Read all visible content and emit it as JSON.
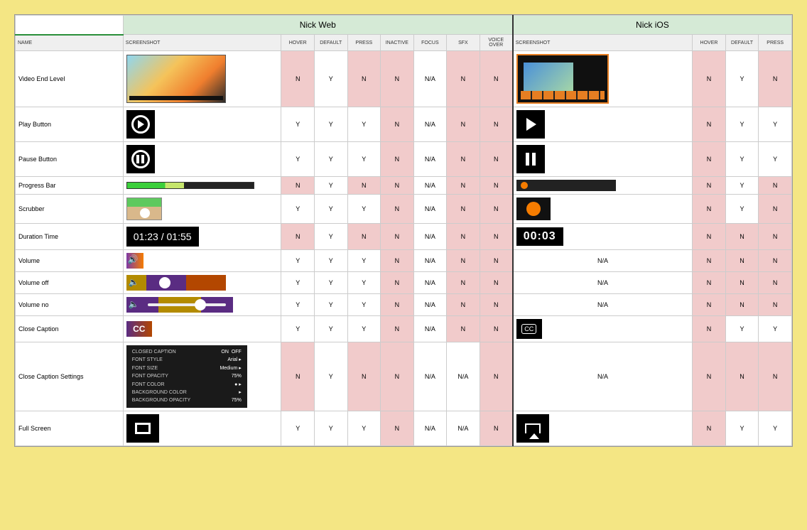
{
  "platforms": {
    "web": "Nick Web",
    "ios": "Nick iOS"
  },
  "col_headers": {
    "name": "NAME",
    "screenshot": "SCREENSHOT",
    "hover": "HOVER",
    "default": "DEFAULT",
    "press": "PRESS",
    "inactive": "INACTIVE",
    "focus": "FOCUS",
    "sfx": "SFX",
    "voice_over": "VOICE OVER"
  },
  "thumbs": {
    "time_web": "01:23 / 01:55",
    "time_ios": "00:03",
    "cc_web": "CC",
    "cc_ios": "CC",
    "cc_settings": {
      "title": "CLOSED CAPTION",
      "toggle_on": "ON",
      "toggle_off": "OFF",
      "font_style": "FONT STYLE",
      "font_style_val": "Arial ▸",
      "font_size": "FONT SIZE",
      "font_size_val": "Medium ▸",
      "font_opacity": "FONT OPACITY",
      "font_opacity_val": "75%",
      "font_color": "FONT COLOR",
      "font_color_val": "● ▸",
      "bg_color": "BACKGROUND COLOR",
      "bg_color_val": "▸",
      "bg_opacity": "BACKGROUND OPACITY",
      "bg_opacity_val": "75%"
    },
    "na": "N/A"
  },
  "rows": [
    {
      "name": "Video End Level",
      "thumb_web": "video1",
      "thumb_ios": "video-ios",
      "web": {
        "hover": "N",
        "default": "Y",
        "press": "N",
        "inactive": "N",
        "focus": "N/A",
        "sfx": "N",
        "vo": "N"
      },
      "ios": {
        "hover": "N",
        "default": "Y",
        "press": "N"
      }
    },
    {
      "name": "Play Button",
      "thumb_web": "play-circle",
      "thumb_ios": "play-tri",
      "web": {
        "hover": "Y",
        "default": "Y",
        "press": "Y",
        "inactive": "N",
        "focus": "N/A",
        "sfx": "N",
        "vo": "N"
      },
      "ios": {
        "hover": "N",
        "default": "Y",
        "press": "Y"
      }
    },
    {
      "name": "Pause Button",
      "thumb_web": "pause-circle",
      "thumb_ios": "pause-bars",
      "web": {
        "hover": "Y",
        "default": "Y",
        "press": "Y",
        "inactive": "N",
        "focus": "N/A",
        "sfx": "N",
        "vo": "N"
      },
      "ios": {
        "hover": "N",
        "default": "Y",
        "press": "Y"
      }
    },
    {
      "name": "Progress Bar",
      "thumb_web": "progress-web",
      "thumb_ios": "progress-ios",
      "web": {
        "hover": "N",
        "default": "Y",
        "press": "N",
        "inactive": "N",
        "focus": "N/A",
        "sfx": "N",
        "vo": "N"
      },
      "ios": {
        "hover": "N",
        "default": "Y",
        "press": "N"
      }
    },
    {
      "name": "Scrubber",
      "thumb_web": "scrub-web",
      "thumb_ios": "scrub-ios",
      "web": {
        "hover": "Y",
        "default": "Y",
        "press": "Y",
        "inactive": "N",
        "focus": "N/A",
        "sfx": "N",
        "vo": "N"
      },
      "ios": {
        "hover": "N",
        "default": "Y",
        "press": "N"
      }
    },
    {
      "name": "Duration Time",
      "thumb_web": "time-web",
      "thumb_ios": "time-ios",
      "web": {
        "hover": "N",
        "default": "Y",
        "press": "N",
        "inactive": "N",
        "focus": "N/A",
        "sfx": "N",
        "vo": "N"
      },
      "ios": {
        "hover": "N",
        "default": "N",
        "press": "N"
      }
    },
    {
      "name": "Volume",
      "thumb_web": "vol",
      "thumb_ios": "na",
      "web": {
        "hover": "Y",
        "default": "Y",
        "press": "Y",
        "inactive": "N",
        "focus": "N/A",
        "sfx": "N",
        "vo": "N"
      },
      "ios": {
        "hover": "N",
        "default": "N",
        "press": "N"
      }
    },
    {
      "name": "Volume off",
      "thumb_web": "vol-off",
      "thumb_ios": "na",
      "web": {
        "hover": "Y",
        "default": "Y",
        "press": "Y",
        "inactive": "N",
        "focus": "N/A",
        "sfx": "N",
        "vo": "N"
      },
      "ios": {
        "hover": "N",
        "default": "N",
        "press": "N"
      }
    },
    {
      "name": "Volume no",
      "thumb_web": "vol-no",
      "thumb_ios": "na",
      "web": {
        "hover": "Y",
        "default": "Y",
        "press": "Y",
        "inactive": "N",
        "focus": "N/A",
        "sfx": "N",
        "vo": "N"
      },
      "ios": {
        "hover": "N",
        "default": "N",
        "press": "N"
      }
    },
    {
      "name": "Close Caption",
      "thumb_web": "cc-web",
      "thumb_ios": "cc-ios",
      "web": {
        "hover": "Y",
        "default": "Y",
        "press": "Y",
        "inactive": "N",
        "focus": "N/A",
        "sfx": "N",
        "vo": "N"
      },
      "ios": {
        "hover": "N",
        "default": "Y",
        "press": "Y"
      }
    },
    {
      "name": "Close Caption Settings",
      "thumb_web": "cc-settings",
      "thumb_ios": "na",
      "web": {
        "hover": "N",
        "default": "Y",
        "press": "N",
        "inactive": "N",
        "focus": "N/A",
        "sfx": "N/A",
        "vo": "N"
      },
      "ios": {
        "hover": "N",
        "default": "N",
        "press": "N"
      }
    },
    {
      "name": "Full Screen",
      "thumb_web": "fs-web",
      "thumb_ios": "airplay",
      "web": {
        "hover": "Y",
        "default": "Y",
        "press": "Y",
        "inactive": "N",
        "focus": "N/A",
        "sfx": "N/A",
        "vo": "N"
      },
      "ios": {
        "hover": "N",
        "default": "Y",
        "press": "Y"
      }
    }
  ]
}
